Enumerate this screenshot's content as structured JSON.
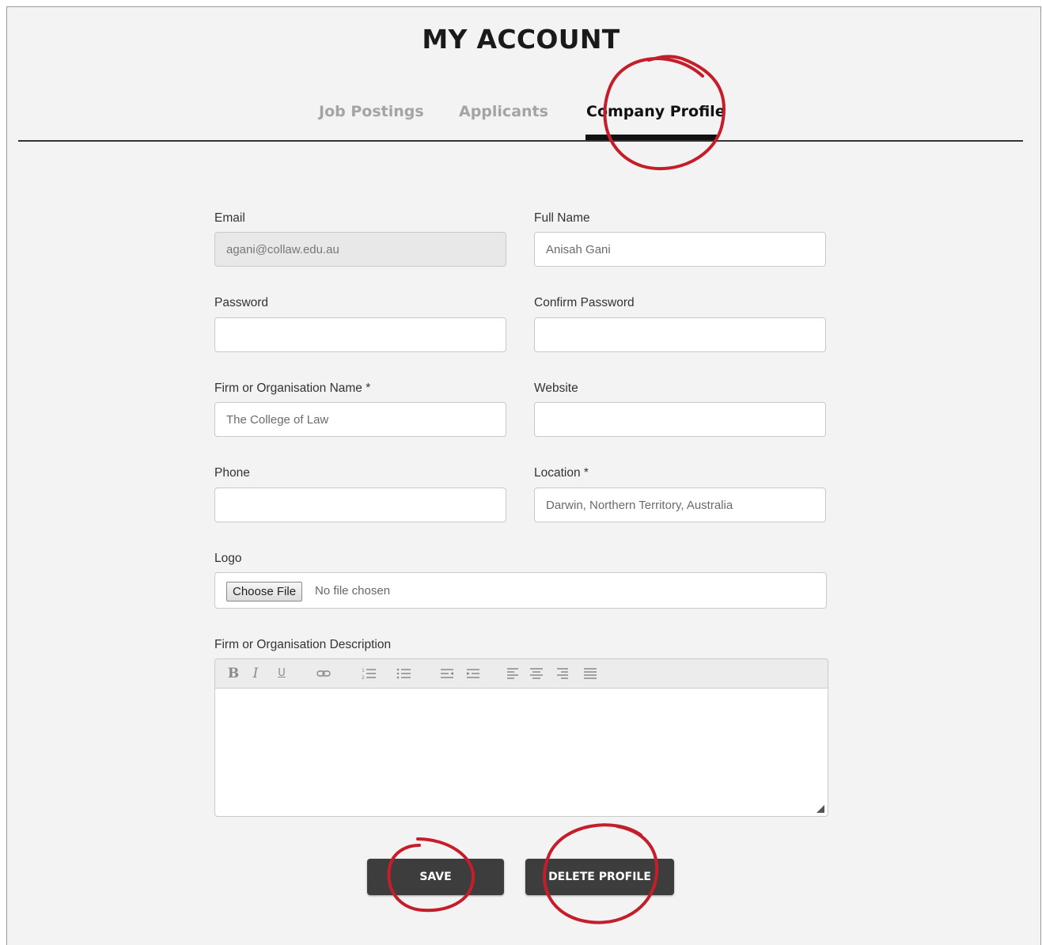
{
  "header": {
    "title": "MY ACCOUNT"
  },
  "tabs": [
    {
      "label": "Job Postings",
      "active": false
    },
    {
      "label": "Applicants",
      "active": false
    },
    {
      "label": "Company Profile",
      "active": true
    }
  ],
  "form": {
    "email": {
      "label": "Email",
      "value": "agani@collaw.edu.au"
    },
    "full_name": {
      "label": "Full Name",
      "value": "Anisah Gani"
    },
    "password": {
      "label": "Password",
      "value": ""
    },
    "confirm_password": {
      "label": "Confirm Password",
      "value": ""
    },
    "firm_name": {
      "label": "Firm or Organisation Name *",
      "value": "The College of Law"
    },
    "website": {
      "label": "Website",
      "value": ""
    },
    "phone": {
      "label": "Phone",
      "value": ""
    },
    "location": {
      "label": "Location *",
      "value": "Darwin, Northern Territory, Australia"
    },
    "logo": {
      "label": "Logo",
      "button_label": "Choose File",
      "status": "No file chosen"
    },
    "description": {
      "label": "Firm or Organisation Description",
      "value": "",
      "toolbar": [
        "bold-icon",
        "italic-icon",
        "underline-icon",
        "link-icon",
        "ordered-list-icon",
        "bullet-list-icon",
        "outdent-icon",
        "indent-icon",
        "align-left-icon",
        "align-center-icon",
        "align-right-icon",
        "justify-icon"
      ]
    }
  },
  "actions": {
    "save_label": "SAVE",
    "delete_label": "DELETE PROFILE"
  },
  "colors": {
    "annotation": "#c41e2a",
    "button_bg": "#3d3d3d",
    "active_tab": "#111111",
    "inactive_tab": "#a4a4a4"
  }
}
